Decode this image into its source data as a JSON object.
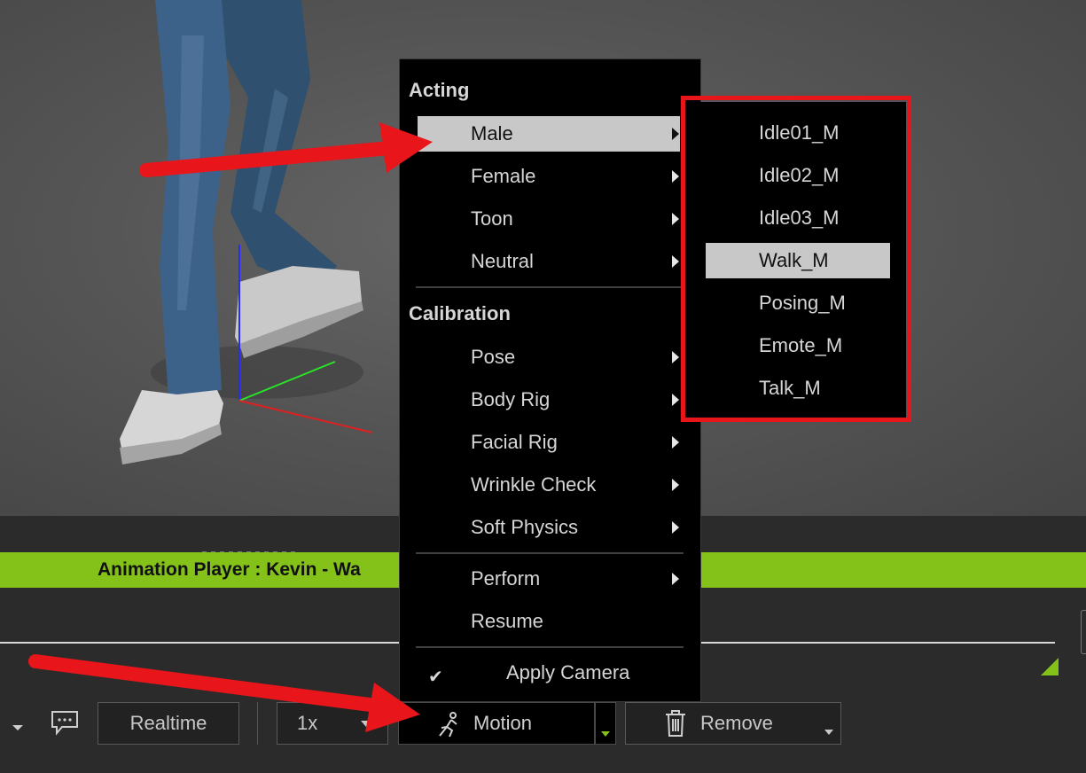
{
  "viewport": {
    "figure_alt": "3D character walking"
  },
  "context_menu": {
    "sections": [
      {
        "heading": "Acting",
        "items": [
          {
            "label": "Male",
            "has_submenu": true,
            "selected": true
          },
          {
            "label": "Female",
            "has_submenu": true
          },
          {
            "label": "Toon",
            "has_submenu": true
          },
          {
            "label": "Neutral",
            "has_submenu": true
          }
        ]
      },
      {
        "heading": "Calibration",
        "items": [
          {
            "label": "Pose",
            "has_submenu": true
          },
          {
            "label": "Body Rig",
            "has_submenu": true
          },
          {
            "label": "Facial Rig",
            "has_submenu": true
          },
          {
            "label": "Wrinkle Check",
            "has_submenu": true
          },
          {
            "label": "Soft Physics",
            "has_submenu": true
          }
        ]
      }
    ],
    "extra_items": [
      {
        "label": "Perform",
        "has_submenu": true
      },
      {
        "label": "Resume",
        "has_submenu": false
      }
    ],
    "apply_camera": {
      "label": "Apply Camera",
      "checked": true,
      "check_glyph": "✔"
    }
  },
  "submenu": {
    "items": [
      "Idle01_M",
      "Idle02_M",
      "Idle03_M",
      "Walk_M",
      "Posing_M",
      "Emote_M",
      "Talk_M"
    ],
    "selected": "Walk_M"
  },
  "panel": {
    "title": "Animation Player : Kevin - Wa",
    "accent_color": "#84c21a"
  },
  "toolbar": {
    "comment_icon": "comment-icon",
    "realtime_label": "Realtime",
    "speed_value": "1x",
    "motion_label": "Motion",
    "motion_icon": "running-figure-icon",
    "remove_label": "Remove",
    "remove_icon": "trash-icon"
  },
  "annotations": {
    "highlight_color": "#e8161a"
  }
}
